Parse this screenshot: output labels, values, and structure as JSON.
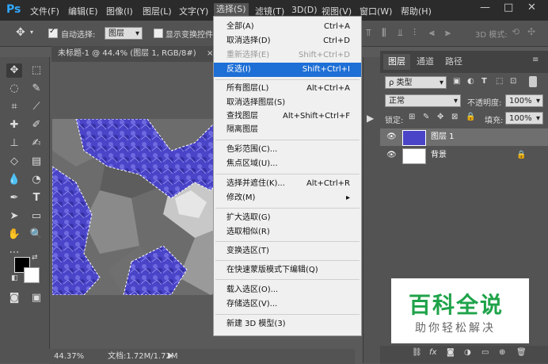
{
  "app": {
    "logo": "Ps"
  },
  "menubar": {
    "items": [
      "文件(F)",
      "编辑(E)",
      "图像(I)",
      "图层(L)",
      "文字(Y)",
      "选择(S)",
      "滤镜(T)",
      "3D(D)",
      "视图(V)",
      "窗口(W)",
      "帮助(H)"
    ],
    "window_buttons": [
      "—",
      "□",
      "✕"
    ]
  },
  "options_bar": {
    "auto_select_label": "自动选择:",
    "auto_select_value": "图层",
    "show_transform_label": "显示变换控件",
    "mode_3d_label": "3D 模式:"
  },
  "document": {
    "tab_title": "未标题-1 @ 44.4% (图层 1, RGB/8#)",
    "tab_close": "×",
    "zoom": "44.37%",
    "doc_info": "文档:1.72M/1.72M"
  },
  "selection_menu": {
    "groups": [
      [
        {
          "label": "全部(A)",
          "shortcut": "Ctrl+A",
          "disabled": false,
          "highlighted": false
        },
        {
          "label": "取消选择(D)",
          "shortcut": "Ctrl+D",
          "disabled": false,
          "highlighted": false
        },
        {
          "label": "重新选择(E)",
          "shortcut": "Shift+Ctrl+D",
          "disabled": true,
          "highlighted": false
        },
        {
          "label": "反选(I)",
          "shortcut": "Shift+Ctrl+I",
          "disabled": false,
          "highlighted": true
        }
      ],
      [
        {
          "label": "所有图层(L)",
          "shortcut": "Alt+Ctrl+A"
        },
        {
          "label": "取消选择图层(S)",
          "shortcut": ""
        },
        {
          "label": "查找图层",
          "shortcut": "Alt+Shift+Ctrl+F"
        },
        {
          "label": "隔离图层",
          "shortcut": ""
        }
      ],
      [
        {
          "label": "色彩范围(C)...",
          "shortcut": ""
        },
        {
          "label": "焦点区域(U)...",
          "shortcut": ""
        }
      ],
      [
        {
          "label": "选择并遮住(K)...",
          "shortcut": "Alt+Ctrl+R"
        },
        {
          "label": "修改(M)",
          "shortcut": "",
          "submenu": true
        }
      ],
      [
        {
          "label": "扩大选取(G)",
          "shortcut": ""
        },
        {
          "label": "选取相似(R)",
          "shortcut": ""
        }
      ],
      [
        {
          "label": "变换选区(T)",
          "shortcut": ""
        }
      ],
      [
        {
          "label": "在快速蒙版模式下编辑(Q)",
          "shortcut": ""
        }
      ],
      [
        {
          "label": "载入选区(O)...",
          "shortcut": ""
        },
        {
          "label": "存储选区(V)...",
          "shortcut": ""
        }
      ],
      [
        {
          "label": "新建 3D 模型(3)",
          "shortcut": ""
        }
      ]
    ]
  },
  "layers_panel": {
    "tabs": [
      "图层",
      "通道",
      "路径"
    ],
    "kind_filter": "ρ 类型",
    "blend_mode": "正常",
    "opacity_label": "不透明度:",
    "opacity_value": "100%",
    "lock_label": "锁定:",
    "fill_label": "填充:",
    "fill_value": "100%",
    "layers": [
      {
        "name": "图层 1",
        "selected": true
      },
      {
        "name": "背景",
        "selected": false,
        "locked": true
      }
    ]
  },
  "watermark": {
    "title": "百科全说",
    "subtitle": "助你轻松解决"
  },
  "colors": {
    "menubar_bg": "#2b2b2b",
    "panel_bg": "#535353",
    "highlight": "#1e6fd6",
    "selection_blue": "#4a44c8",
    "watermark_green": "#1fa34a"
  }
}
